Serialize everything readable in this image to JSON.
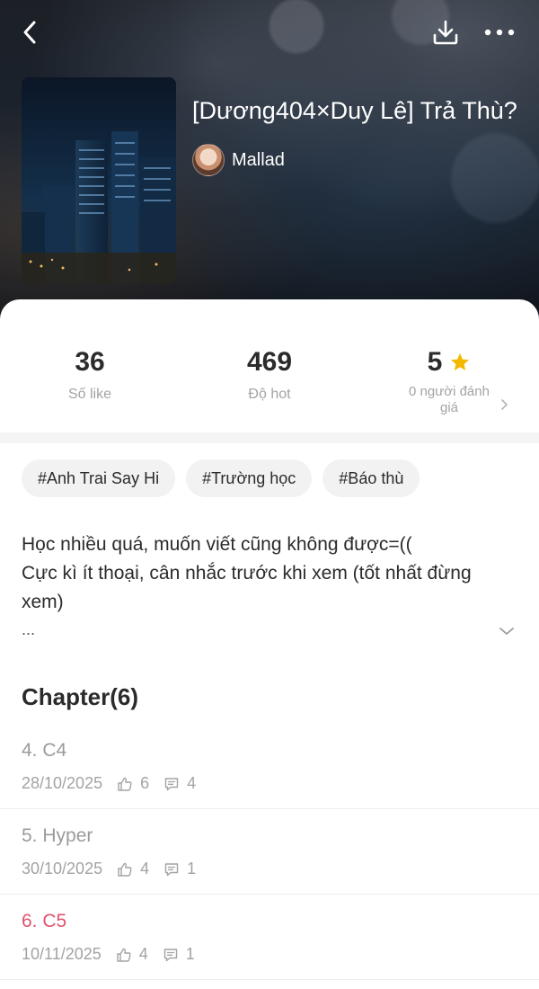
{
  "header": {
    "back_icon": "chevron-left-icon",
    "download_icon": "download-icon",
    "more_icon": "more-horizontal-icon"
  },
  "book": {
    "title": "[Dương404×Duy Lê] Trả Thù?",
    "author": "Mallad",
    "cover_description_icon": "city-night-cover"
  },
  "stats": {
    "likes_value": "36",
    "likes_label": "Số like",
    "hot_value": "469",
    "hot_label": "Độ hot",
    "rating_value": "5",
    "rating_label": "0 người đánh giá",
    "star_color": "#f5b800"
  },
  "tags": [
    "#Anh Trai Say Hi",
    "#Trường học",
    "#Báo thù"
  ],
  "description": {
    "line1": "Học nhiều quá, muốn viết cũng không được=((",
    "line2": "Cực kì ít thoại, cân nhắc trước khi xem (tốt nhất đừng xem)",
    "ellipsis": "..."
  },
  "chapters": {
    "heading": "Chapter(6)",
    "items": [
      {
        "title": "4. C4",
        "date": "28/10/2025",
        "likes": "6",
        "comments": "4",
        "current": false
      },
      {
        "title": "5. Hyper",
        "date": "30/10/2025",
        "likes": "4",
        "comments": "1",
        "current": false
      },
      {
        "title": "6. C5",
        "date": "10/11/2025",
        "likes": "4",
        "comments": "1",
        "current": true
      }
    ]
  },
  "colors": {
    "accent_current_chapter": "#e0526e",
    "muted_text": "#a3a3a3",
    "tag_background": "#f2f2f2"
  }
}
